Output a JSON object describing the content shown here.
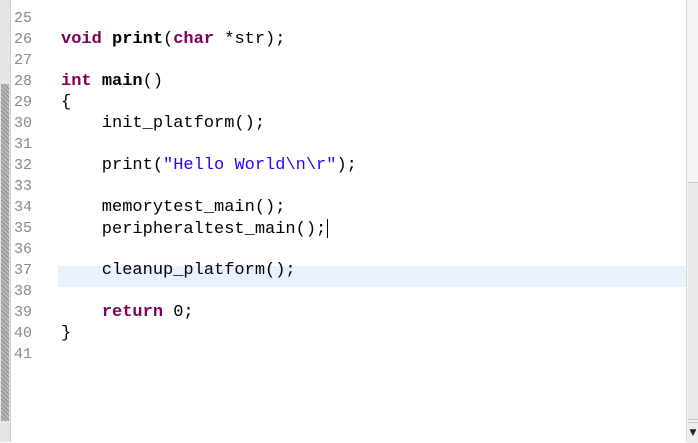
{
  "editor": {
    "lines": [
      {
        "n": "25",
        "tokens": []
      },
      {
        "n": "26",
        "tokens": [
          [
            "kw",
            "void"
          ],
          [
            "p",
            " "
          ],
          [
            "fn",
            "print"
          ],
          [
            "p",
            "("
          ],
          [
            "kw",
            "char"
          ],
          [
            "p",
            " *str);"
          ]
        ]
      },
      {
        "n": "27",
        "tokens": []
      },
      {
        "n": "28",
        "tokens": [
          [
            "kw",
            "int"
          ],
          [
            "p",
            " "
          ],
          [
            "fn",
            "main"
          ],
          [
            "p",
            "()"
          ]
        ]
      },
      {
        "n": "29",
        "tokens": [
          [
            "p",
            "{"
          ]
        ]
      },
      {
        "n": "30",
        "tokens": [
          [
            "p",
            "    init_platform();"
          ]
        ]
      },
      {
        "n": "31",
        "tokens": []
      },
      {
        "n": "32",
        "tokens": [
          [
            "p",
            "    print("
          ],
          [
            "str",
            "\"Hello World\\n\\r\""
          ],
          [
            "p",
            ");"
          ]
        ]
      },
      {
        "n": "33",
        "tokens": []
      },
      {
        "n": "34",
        "tokens": [
          [
            "p",
            "    memorytest_main();"
          ]
        ]
      },
      {
        "n": "35",
        "tokens": [
          [
            "p",
            "    peripheraltest_main();"
          ]
        ],
        "current": true
      },
      {
        "n": "36",
        "tokens": []
      },
      {
        "n": "37",
        "tokens": [
          [
            "p",
            "    cleanup_platform();"
          ]
        ]
      },
      {
        "n": "38",
        "tokens": []
      },
      {
        "n": "39",
        "tokens": [
          [
            "p",
            "    "
          ],
          [
            "kw",
            "return"
          ],
          [
            "p",
            " 0;"
          ]
        ]
      },
      {
        "n": "40",
        "tokens": [
          [
            "p",
            "}"
          ]
        ]
      },
      {
        "n": "41",
        "tokens": []
      }
    ]
  },
  "scrollbar": {
    "down_arrow": "▼"
  },
  "colors": {
    "keyword": "#7f0055",
    "string": "#2a00ff",
    "line_number": "#888888",
    "current_line": "#e8f2fe"
  },
  "icons": {
    "scroll_down": "scroll-down-arrow-icon"
  }
}
